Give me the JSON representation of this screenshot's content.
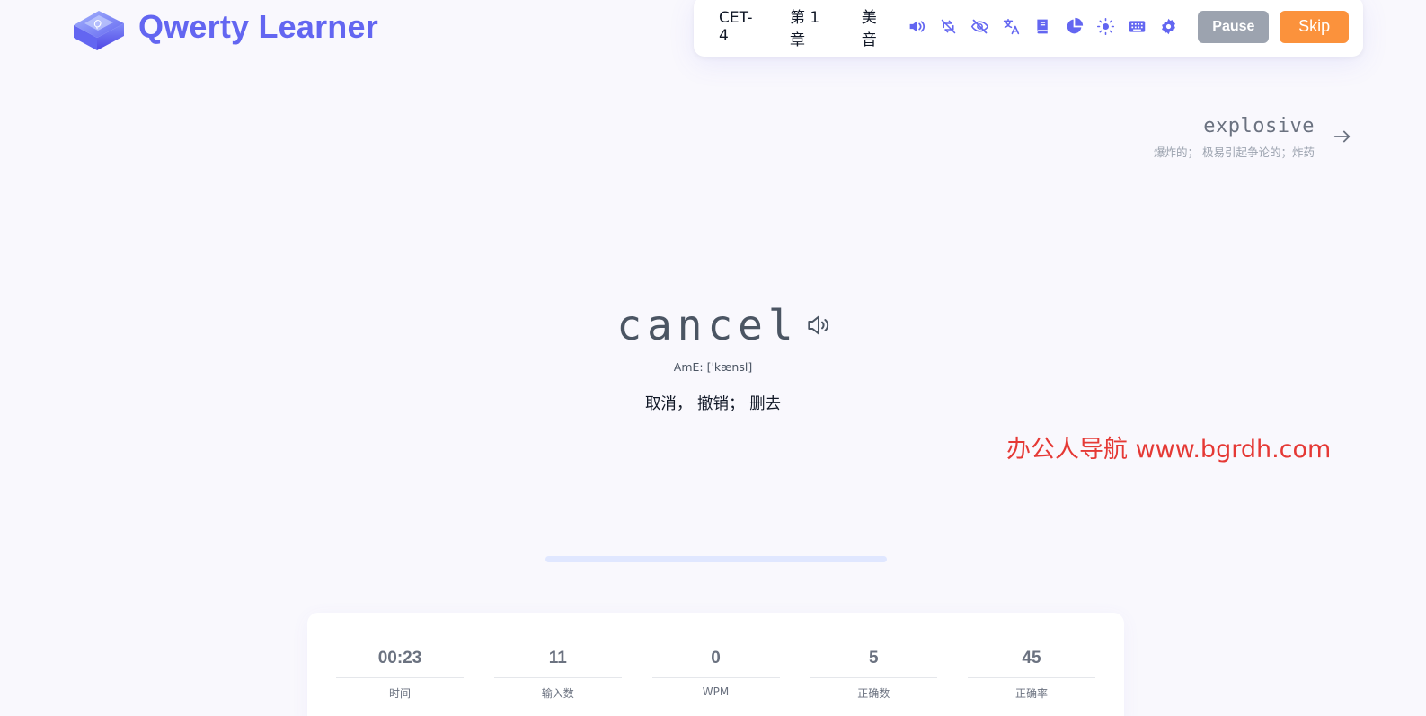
{
  "app": {
    "title": "Qwerty Learner"
  },
  "toolbar": {
    "dictionary": "CET-4",
    "chapter": "第 1 章",
    "pronunciation": "美音",
    "icons": [
      "sound-icon",
      "loop-off-icon",
      "hide-eye-icon",
      "translate-icon",
      "dictionary-book-icon",
      "stats-pie-icon",
      "theme-sun-icon",
      "keyboard-icon",
      "settings-gear-icon"
    ],
    "pause_label": "Pause",
    "skip_label": "Skip",
    "accent_color": "#6366f1",
    "pause_color": "#9ca3af",
    "skip_color": "#fb923c"
  },
  "next_word": {
    "word": "explosive",
    "translation": "爆炸的； 极易引起争论的；炸药"
  },
  "current_word": {
    "word": "cancel",
    "phonetic": "AmE: [ˈkænsl]",
    "translation": "取消， 撤销； 删去"
  },
  "watermark": "办公人导航 www.bgrdh.com",
  "progress": {
    "fraction": 0.0
  },
  "stats": [
    {
      "value": "00:23",
      "label": "时间"
    },
    {
      "value": "11",
      "label": "输入数"
    },
    {
      "value": "0",
      "label": "WPM"
    },
    {
      "value": "5",
      "label": "正确数"
    },
    {
      "value": "45",
      "label": "正确率"
    }
  ]
}
